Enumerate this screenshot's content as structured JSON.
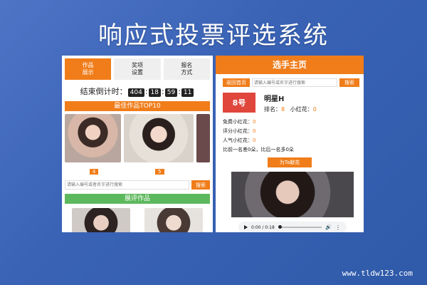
{
  "banner": {
    "title": "响应式投票评选系统",
    "watermark": "www.tldw123.com"
  },
  "left": {
    "tabs": [
      {
        "label": "作品\n展示",
        "active": true
      },
      {
        "label": "奖项\n设置",
        "active": false
      },
      {
        "label": "报名\n方式",
        "active": false
      }
    ],
    "countdown": {
      "label": "结束倒计时：",
      "days": "404",
      "hours": "18",
      "minutes": "59",
      "seconds": "11"
    },
    "best_works": "最佳作品TOP10",
    "votes": [
      "4",
      "5"
    ],
    "search_placeholder": "请输入编号或者名字进行搜索",
    "search_button": "搜索",
    "review_works": "展评作品"
  },
  "right": {
    "header": "选手主页",
    "back_button": "返回首页",
    "search_placeholder": "请输入编号或名字进行搜索",
    "search_button": "搜索",
    "number": "8号",
    "name": "明星H",
    "rank_label": "排名：",
    "rank_value": "8",
    "flower_label": "小红花：",
    "flower_value": "0",
    "stats": [
      {
        "label": "免费小红花：",
        "value": "0"
      },
      {
        "label": "评分小红花：",
        "value": "0"
      },
      {
        "label": "人气小红花：",
        "value": "0"
      }
    ],
    "compare": "比前一名差0朵，比后一名多0朵",
    "gift_button": "为Ta献花",
    "audio_time": "0:00 / 0:18"
  },
  "colors": {
    "accent": "#f07d1a",
    "green": "#5cb85c",
    "badge_red": "#e0463c",
    "background": "#3a63b6"
  }
}
